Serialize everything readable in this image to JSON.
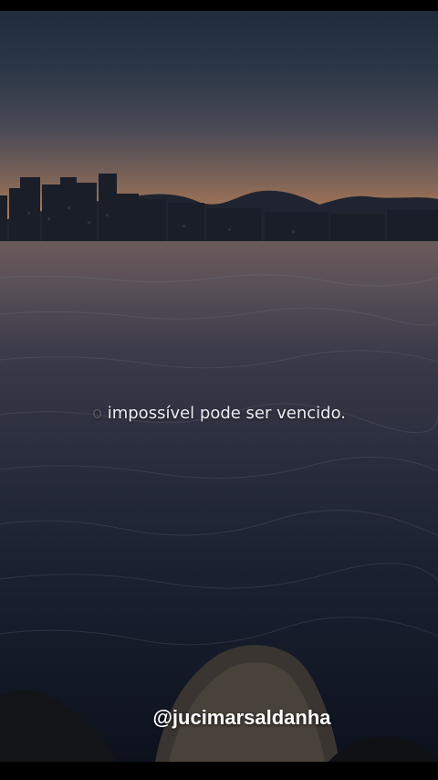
{
  "caption": {
    "faded_word": "o",
    "text": "impossível pode ser vencido."
  },
  "watermark": {
    "handle": "@jucimarsaldanha"
  },
  "colors": {
    "sky_top": "#202b3b",
    "horizon_glow": "#c98f5f",
    "sea_dark": "#0d111c",
    "text": "#eceef2"
  }
}
